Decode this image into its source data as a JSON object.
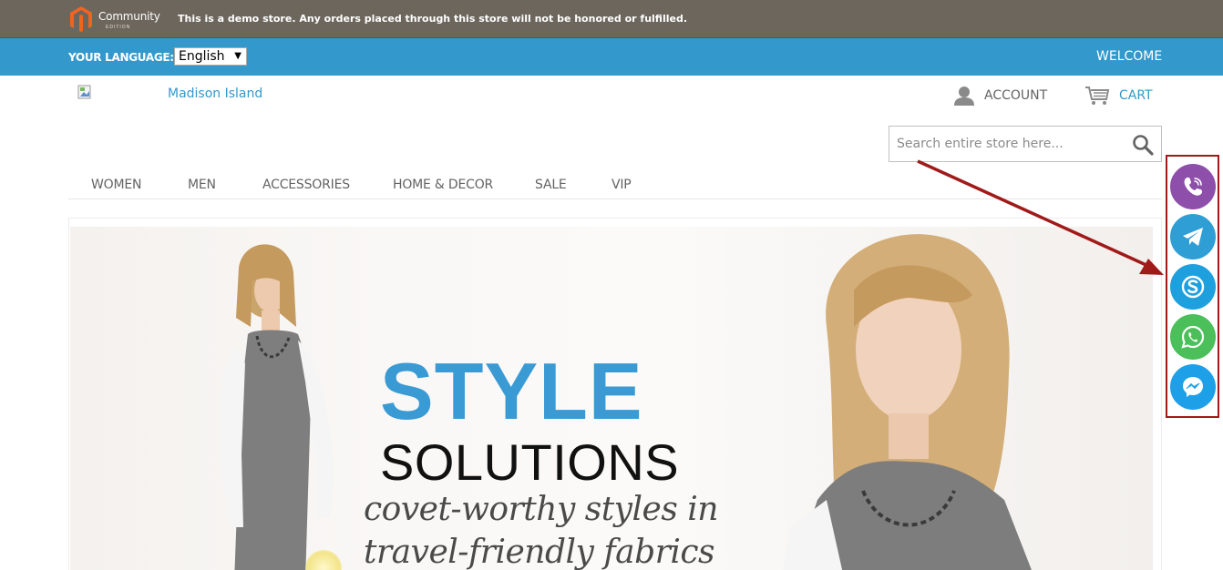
{
  "demo_notice": {
    "logo_word": "Community",
    "logo_edition": "EDITION",
    "text": "This is a demo store. Any orders placed through this store will not be honored or fulfilled."
  },
  "language_bar": {
    "label": "YOUR LANGUAGE:",
    "selected": "English",
    "welcome": "WELCOME"
  },
  "header": {
    "store_name": "Madison Island",
    "account_label": "ACCOUNT",
    "cart_label": "CART",
    "search_placeholder": "Search entire store here..."
  },
  "nav": {
    "items": [
      "WOMEN",
      "MEN",
      "ACCESSORIES",
      "HOME & DECOR",
      "SALE",
      "VIP"
    ]
  },
  "hero": {
    "title": "STYLE",
    "subtitle": "SOLUTIONS",
    "tagline_line1": "covet-worthy styles in",
    "tagline_line2": "travel-friendly fabrics"
  },
  "social": {
    "buttons": [
      {
        "icon": "viber-icon",
        "color": "#8e4fab"
      },
      {
        "icon": "telegram-icon",
        "color": "#2e9ed5"
      },
      {
        "icon": "skype-icon",
        "color": "#1ea0de"
      },
      {
        "icon": "whatsapp-icon",
        "color": "#4bbf59"
      },
      {
        "icon": "messenger-icon",
        "color": "#1ea0e8"
      }
    ]
  },
  "colors": {
    "demo_bar": "#6d665d",
    "accent_blue": "#3399cc",
    "annotation_red": "#a11a1a"
  }
}
